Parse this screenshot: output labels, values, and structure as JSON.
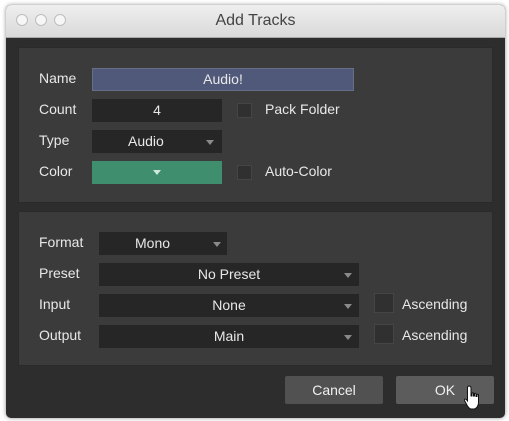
{
  "window": {
    "title": "Add Tracks"
  },
  "track": {
    "name_label": "Name",
    "name_value": "Audio!",
    "count_label": "Count",
    "count_value": "4",
    "pack_folder_label": "Pack Folder",
    "type_label": "Type",
    "type_value": "Audio",
    "color_label": "Color",
    "color_value": "#3f8f6f",
    "auto_color_label": "Auto-Color"
  },
  "io": {
    "format_label": "Format",
    "format_value": "Mono",
    "preset_label": "Preset",
    "preset_value": "No Preset",
    "input_label": "Input",
    "input_value": "None",
    "input_ascending_label": "Ascending",
    "output_label": "Output",
    "output_value": "Main",
    "output_ascending_label": "Ascending"
  },
  "buttons": {
    "cancel": "Cancel",
    "ok": "OK"
  }
}
